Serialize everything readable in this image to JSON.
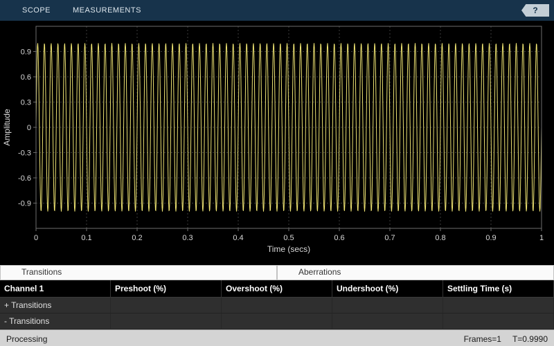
{
  "toolbar": {
    "tabs": [
      {
        "label": "SCOPE"
      },
      {
        "label": "MEASUREMENTS"
      }
    ],
    "help_label": "?"
  },
  "panels": {
    "transitions": "Transitions",
    "aberrations": "Aberrations"
  },
  "table": {
    "headers": [
      "Channel 1",
      "Preshoot (%)",
      "Overshoot (%)",
      "Undershoot (%)",
      "Settling Time (s)"
    ],
    "rows": [
      {
        "label": "+ Transitions",
        "cells": [
          "",
          "",
          "",
          ""
        ]
      },
      {
        "label": "- Transitions",
        "cells": [
          "",
          "",
          "",
          ""
        ]
      }
    ]
  },
  "status": {
    "left": "Processing",
    "frames": "Frames=1",
    "time": "T=0.9990"
  },
  "colors": {
    "toolbar_bg": "#17334b",
    "plot_bg": "#000000",
    "signal": "#efe473",
    "grid": "#3c3c3c",
    "axis": "#6e6e6e",
    "tick_text": "#d9d9d9"
  },
  "chart_data": {
    "type": "line",
    "title": "",
    "xlabel": "Time (secs)",
    "ylabel": "Amplitude",
    "xlim": [
      0,
      1
    ],
    "ylim": [
      -1.2,
      1.2
    ],
    "xticks": [
      0,
      0.1,
      0.2,
      0.3,
      0.4,
      0.5,
      0.6,
      0.7,
      0.8,
      0.9,
      1
    ],
    "xtick_labels": [
      "0",
      "0.1",
      "0.2",
      "0.3",
      "0.4",
      "0.5",
      "0.6",
      "0.7",
      "0.8",
      "0.9",
      "1"
    ],
    "yticks": [
      -0.9,
      -0.6,
      -0.3,
      0,
      0.3,
      0.6,
      0.9
    ],
    "ytick_labels": [
      "-0.9",
      "-0.6",
      "-0.3",
      "0",
      "0.3",
      "0.6",
      "0.9"
    ],
    "grid": true,
    "legend": false,
    "series": [
      {
        "name": "Channel 1",
        "waveform": "sine",
        "amplitude": 1,
        "frequency_hz": 75,
        "color": "#efe473"
      }
    ]
  }
}
